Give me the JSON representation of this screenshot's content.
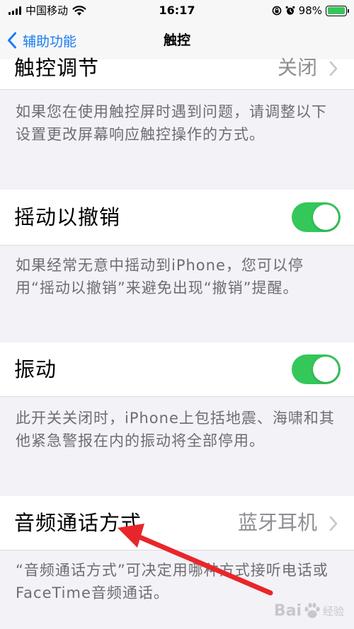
{
  "status_bar": {
    "carrier": "中国移动",
    "time": "16:17",
    "battery_percent": "98%",
    "battery_level": 0.98,
    "icons": [
      "signal-bars-icon",
      "wifi-icon",
      "orientation-lock-icon",
      "alarm-icon",
      "battery-icon"
    ]
  },
  "nav": {
    "back_label": "辅助功能",
    "title": "触控"
  },
  "settings": {
    "touch_accommodations": {
      "label": "触控调节",
      "value": "关闭"
    },
    "touch_accommodations_footer": "如果您在使用触控屏时遇到问题，请调整以下设置更改屏幕响应触控操作的方式。",
    "shake_to_undo": {
      "label": "摇动以撤销",
      "enabled": true
    },
    "shake_to_undo_footer": "如果经常无意中摇动到iPhone，您可以停用“摇动以撤销”来避免出现“撤销”提醒。",
    "vibration": {
      "label": "振动",
      "enabled": true
    },
    "vibration_footer": "此开关关闭时，iPhone上包括地震、海啸和其他紧急警报在内的振动将全部停用。",
    "call_audio_routing": {
      "label": "音频通话方式",
      "value": "蓝牙耳机"
    },
    "call_audio_routing_footer": "“音频通话方式”可决定用哪种方式接听电话或FaceTime音频通话。"
  },
  "watermark": {
    "brand": "Bai",
    "suffix": "经验"
  },
  "colors": {
    "toggle_on": "#34c759",
    "link": "#1a7cf5",
    "annotation_arrow": "#e8262a",
    "background": "#f2f2f7"
  }
}
